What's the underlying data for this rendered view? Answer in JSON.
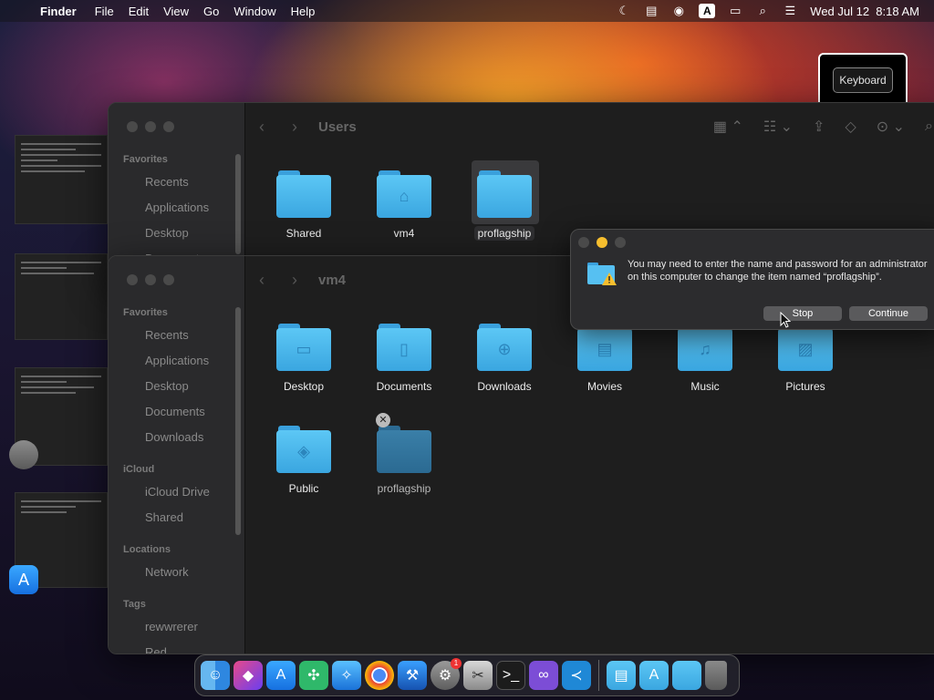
{
  "menubar": {
    "app_name": "Finder",
    "items": [
      "File",
      "Edit",
      "View",
      "Go",
      "Window",
      "Help"
    ],
    "input_source": "A",
    "datetime": "Wed Jul 12  8:18 AM"
  },
  "keyboard_tooltip": "Keyboard",
  "finder_users": {
    "title": "Users",
    "sidebar": {
      "favorites_header": "Favorites",
      "items": [
        "Recents",
        "Applications",
        "Desktop",
        "Documents"
      ]
    },
    "folders": [
      {
        "label": "Shared",
        "icon": "folder-icon"
      },
      {
        "label": "vm4",
        "icon": "home-folder-icon"
      },
      {
        "label": "proflagship",
        "icon": "folder-icon"
      }
    ]
  },
  "finder_vm4": {
    "title": "vm4",
    "sidebar": {
      "favorites_header": "Favorites",
      "favorites": [
        "Recents",
        "Applications",
        "Desktop",
        "Documents",
        "Downloads"
      ],
      "icloud_header": "iCloud",
      "icloud": [
        "iCloud Drive",
        "Shared"
      ],
      "locations_header": "Locations",
      "locations": [
        "Network"
      ],
      "tags_header": "Tags",
      "tags": [
        "rewwrerer",
        "Red"
      ]
    },
    "folders": [
      {
        "label": "Desktop",
        "icon": "desktop-folder-icon"
      },
      {
        "label": "Documents",
        "icon": "documents-folder-icon"
      },
      {
        "label": "Downloads",
        "icon": "downloads-folder-icon"
      },
      {
        "label": "Movies",
        "icon": "movies-folder-icon"
      },
      {
        "label": "Music",
        "icon": "music-folder-icon"
      },
      {
        "label": "Pictures",
        "icon": "pictures-folder-icon"
      },
      {
        "label": "Public",
        "icon": "public-folder-icon"
      },
      {
        "label": "proflagship",
        "icon": "folder-icon"
      }
    ]
  },
  "dialog": {
    "message": "You may need to enter the name and password for an administrator on this computer to change the item named “proflagship”.",
    "stop_label": "Stop",
    "continue_label": "Continue"
  },
  "dock": {
    "apps": [
      "Finder",
      "Shortcuts",
      "App Store",
      "Xcode Tools",
      "Safari",
      "Chrome",
      "Xcode",
      "System Settings",
      "Utility",
      "Terminal",
      "Visual Studio",
      "VS Code"
    ],
    "settings_badge": "1"
  },
  "colors": {
    "folder_blue": "#4bb8ee",
    "dialog_bg": "#2c2c2e",
    "traffic_yellow": "#f6be2e"
  }
}
